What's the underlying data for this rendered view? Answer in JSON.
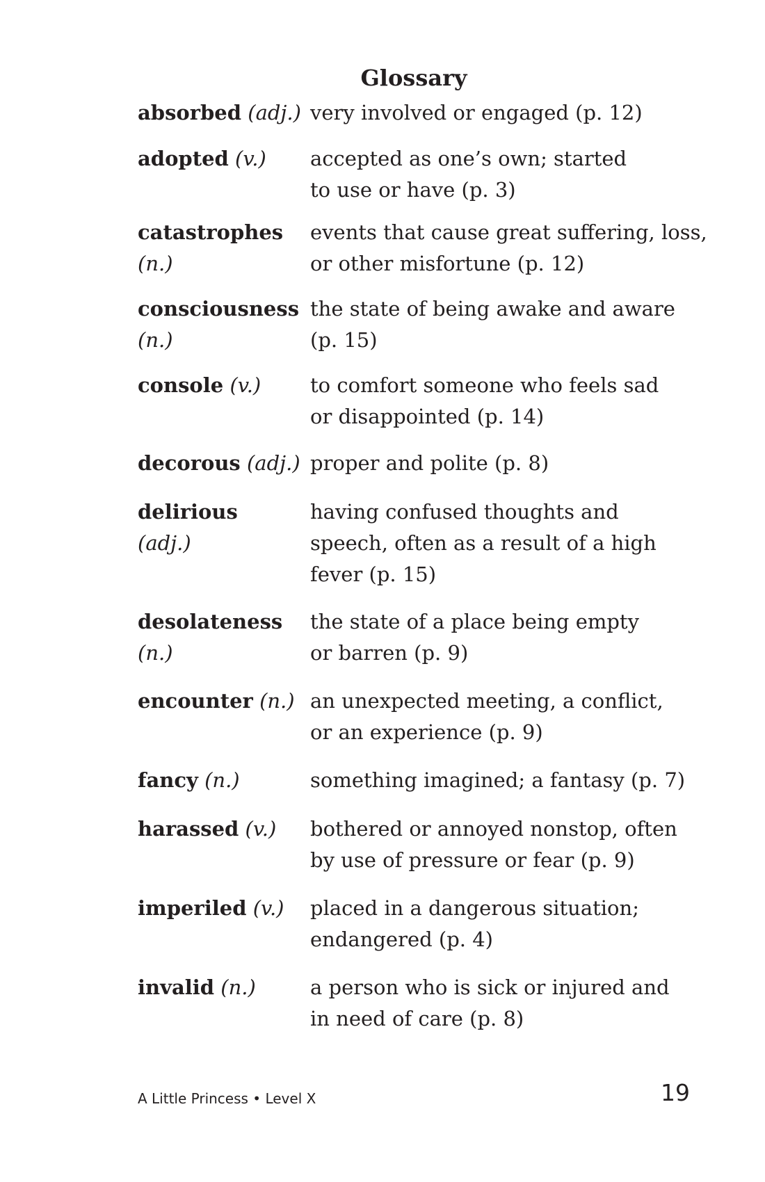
{
  "title": "Glossary",
  "entries": [
    {
      "word": "absorbed",
      "pos": "(adj.)",
      "definition": "very involved or engaged (p. 12)"
    },
    {
      "word": "adopted",
      "pos": "(v.)",
      "definition": "accepted as one’s own; started\nto use or have (p. 3)"
    },
    {
      "word": "catastrophes",
      "pos": "(n.)",
      "definition": "events that cause great suffering, loss,\nor other misfortune (p. 12)"
    },
    {
      "word": "consciousness",
      "pos": "(n.)",
      "definition": "the state of being awake and aware\n(p. 15)"
    },
    {
      "word": "console",
      "pos": "(v.)",
      "definition": "to comfort someone who feels sad\nor disappointed (p. 14)"
    },
    {
      "word": "decorous",
      "pos": "(adj.)",
      "definition": "proper and polite (p. 8)"
    },
    {
      "word": "delirious",
      "pos": "(adj.)",
      "definition": "having confused thoughts and\nspeech, often as a result of a high\nfever (p. 15)"
    },
    {
      "word": "desolateness",
      "pos": "(n.)",
      "definition": "the state of a place being empty\nor barren (p. 9)"
    },
    {
      "word": "encounter",
      "pos": "(n.)",
      "definition": "an unexpected meeting, a conflict,\nor an experience (p. 9)"
    },
    {
      "word": "fancy",
      "pos": "(n.)",
      "definition": "something imagined; a fantasy (p. 7)"
    },
    {
      "word": "harassed",
      "pos": "(v.)",
      "definition": "bothered or annoyed nonstop, often\nby use of pressure or fear (p. 9)"
    },
    {
      "word": "imperiled",
      "pos": "(v.)",
      "definition": "placed in a dangerous situation;\nendangered (p. 4)"
    },
    {
      "word": "invalid",
      "pos": "(n.)",
      "definition": "a person who is sick or injured and\nin need of care (p. 8)"
    }
  ],
  "footer": {
    "book": "A Little Princess • Level X",
    "page_number": "19"
  }
}
